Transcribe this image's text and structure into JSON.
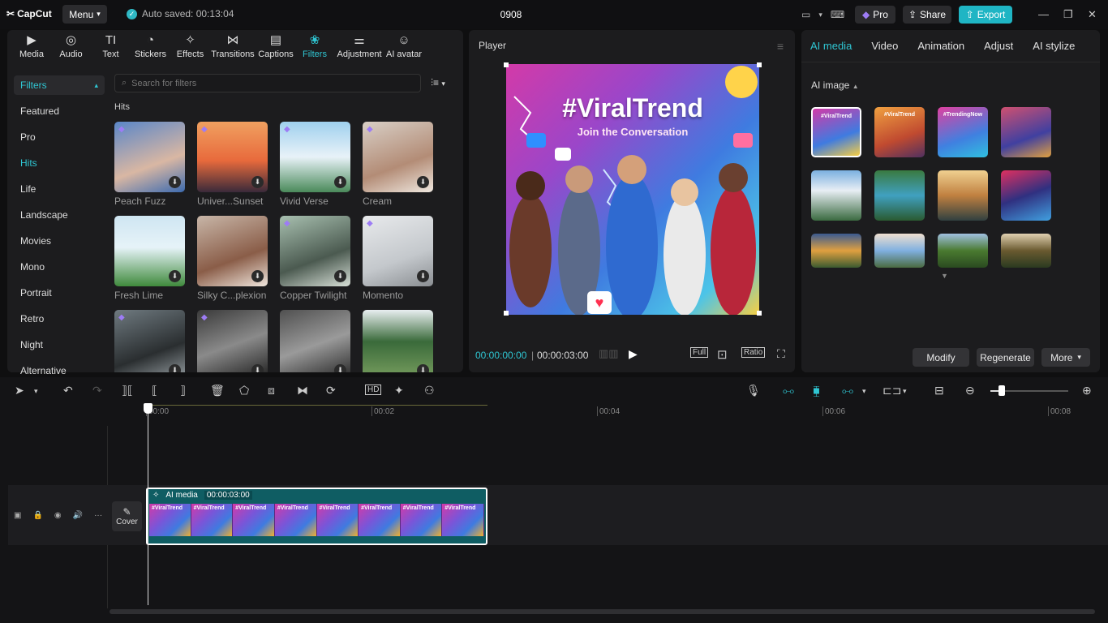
{
  "app": {
    "name": "CapCut",
    "menu_label": "Menu",
    "autosave": "Auto saved: 00:13:04",
    "project": "0908"
  },
  "titlebar": {
    "pro": "Pro",
    "share": "Share",
    "export": "Export"
  },
  "tool_tabs": [
    {
      "label": "Media",
      "icon": "media-icon"
    },
    {
      "label": "Audio",
      "icon": "audio-icon"
    },
    {
      "label": "Text",
      "icon": "text-icon"
    },
    {
      "label": "Stickers",
      "icon": "sticker-icon"
    },
    {
      "label": "Effects",
      "icon": "effects-icon"
    },
    {
      "label": "Transitions",
      "icon": "transition-icon"
    },
    {
      "label": "Captions",
      "icon": "captions-icon"
    },
    {
      "label": "Filters",
      "icon": "filters-icon"
    },
    {
      "label": "Adjustment",
      "icon": "adjustment-icon"
    },
    {
      "label": "AI avatar",
      "icon": "ai-avatar-icon"
    }
  ],
  "sidebar": {
    "active": "Filters",
    "items": [
      "Featured",
      "Pro",
      "Hits",
      "Life",
      "Landscape",
      "Movies",
      "Mono",
      "Portrait",
      "Retro",
      "Night",
      "Alternative"
    ]
  },
  "search": {
    "placeholder": "Search for filters"
  },
  "filters": {
    "section": "Hits",
    "cards": [
      {
        "label": "Peach Fuzz",
        "pro": true,
        "bg": "linear-gradient(160deg,#5a86c8,#d9b7a3 60%,#3d6bb0)"
      },
      {
        "label": "Univer...Sunset",
        "pro": true,
        "bg": "linear-gradient(180deg,#f0a060,#e86a3c 55%,#3a2a3a)"
      },
      {
        "label": "Vivid Verse",
        "pro": true,
        "bg": "linear-gradient(180deg,#9fd0ee,#e8f2f8 50%,#4a8a5a)"
      },
      {
        "label": "Cream",
        "pro": true,
        "bg": "linear-gradient(160deg,#d8cfc6,#b38c76 60%,#efe8e0)"
      },
      {
        "label": "Fresh Lime",
        "pro": false,
        "bg": "linear-gradient(180deg,#cfe6f2,#e6f3f8 45%,#3f8a3c)"
      },
      {
        "label": "Silky C...plexion",
        "pro": false,
        "bg": "linear-gradient(160deg,#c8b6a8,#8a5d48 60%,#f0e6dd)"
      },
      {
        "label": "Copper Twilight",
        "pro": true,
        "bg": "linear-gradient(160deg,#a8c0b0,#4b5a50 60%,#d8e0d8)"
      },
      {
        "label": "Momento",
        "pro": true,
        "bg": "linear-gradient(160deg,#e8eaec,#c4c8cc 60%,#8a8e92)"
      },
      {
        "label": "",
        "pro": true,
        "bg": "linear-gradient(160deg,#6f7a80,#2a2e30 60%,#9aa2a6)"
      },
      {
        "label": "",
        "pro": true,
        "bg": "linear-gradient(160deg,#3a3a3a,#8a8a8a 50%,#1a1a1a)"
      },
      {
        "label": "",
        "pro": false,
        "bg": "linear-gradient(160deg,#505050,#9a9a9a 50%,#202020)"
      },
      {
        "label": "",
        "pro": false,
        "bg": "linear-gradient(180deg,#e8eef0,#3a6a3a 45%,#7aa060)"
      }
    ]
  },
  "player": {
    "title": "Player",
    "headline": "#ViralTrend",
    "subline": "Join the Conversation",
    "current": "00:00:00:00",
    "total": "00:00:03:00",
    "full": "Full",
    "ratio": "Ratio"
  },
  "right": {
    "tabs": [
      "AI media",
      "Video",
      "Animation",
      "Adjust",
      "AI stylize"
    ],
    "section": "AI image",
    "thumbs": [
      {
        "bg": "linear-gradient(160deg,#d33aa8,#3f7be0 60%,#f7cf44)",
        "label": "#ViralTrend"
      },
      {
        "bg": "linear-gradient(160deg,#f0a040,#c04a30 60%,#503060)",
        "label": "#ViralTrend"
      },
      {
        "bg": "linear-gradient(160deg,#e040a0,#4080e0 60%,#30c0e0)",
        "label": "#TrendingNow"
      },
      {
        "bg": "linear-gradient(160deg,#d05070,#4040a0 60%,#e0a040)",
        "label": ""
      },
      {
        "bg": "linear-gradient(180deg,#7ab0e0,#e8eef4 40%,#3a6a40)",
        "label": ""
      },
      {
        "bg": "linear-gradient(180deg,#3a7a40,#40a0c0 50%,#2a5a30)",
        "label": ""
      },
      {
        "bg": "linear-gradient(180deg,#f0d090,#c08040 50%,#304040)",
        "label": ""
      },
      {
        "bg": "linear-gradient(160deg,#e03060,#303080 50%,#40a0e0)",
        "label": ""
      },
      {
        "bg": "linear-gradient(180deg,#3a5a90,#e0a040 50%,#3a5a30)",
        "label": ""
      },
      {
        "bg": "linear-gradient(180deg,#f0e0d0,#80b0e0 50%,#4a6a40)",
        "label": ""
      },
      {
        "bg": "linear-gradient(180deg,#a0c0e0,#4a7a30 50%,#2a4a20)",
        "label": ""
      },
      {
        "bg": "linear-gradient(180deg,#e0d0b0,#6a5a30 50%,#2a3a20)",
        "label": ""
      }
    ],
    "buttons": {
      "modify": "Modify",
      "regenerate": "Regenerate",
      "more": "More"
    }
  },
  "timeline": {
    "ticks": [
      "00:00",
      "00:02",
      "00:04",
      "00:06",
      "00:08"
    ],
    "cover": "Cover",
    "clip_name": "AI media",
    "clip_duration": "00:00:03:00",
    "frame_label": "#ViralTrend"
  },
  "colors": {
    "accent": "#2fc6d3",
    "export": "#1fb5c4",
    "clip": "#0f5d63"
  }
}
